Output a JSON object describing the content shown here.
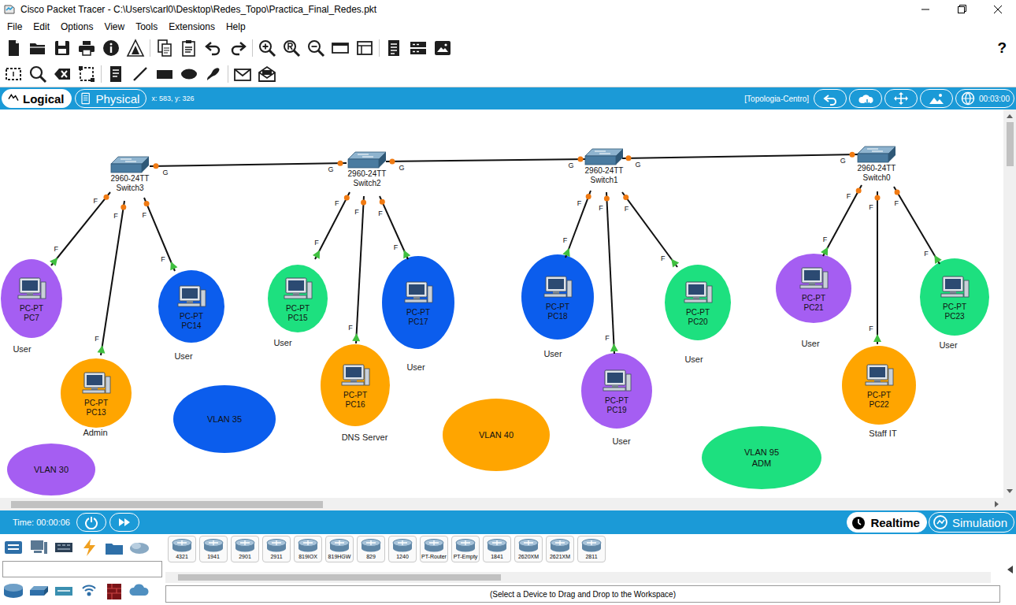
{
  "window": {
    "title": "Cisco Packet Tracer - C:\\Users\\carl0\\Desktop\\Redes_Topo\\Practica_Final_Redes.pkt"
  },
  "menu": [
    "File",
    "Edit",
    "Options",
    "View",
    "Tools",
    "Extensions",
    "Help"
  ],
  "toolbar": {
    "help": "?"
  },
  "view_tabs": [
    {
      "label": "Logical",
      "selected": true
    },
    {
      "label": "Physical",
      "selected": false
    }
  ],
  "cursor": "x: 583, y: 326",
  "workspace": "[Topologia-Centro]",
  "clock": "00:03:00",
  "switches": [
    {
      "model": "2960-24TT",
      "name": "Switch3"
    },
    {
      "model": "2960-24TT",
      "name": "Switch2"
    },
    {
      "model": "2960-24TT",
      "name": "Switch1"
    },
    {
      "model": "2960-24TT",
      "name": "Switch0"
    }
  ],
  "pcs": [
    {
      "type": "PC-PT",
      "name": "PC7",
      "role": "User",
      "color": "#a55ef2"
    },
    {
      "type": "PC-PT",
      "name": "PC13",
      "role": "Admin",
      "color": "#ffa500"
    },
    {
      "type": "PC-PT",
      "name": "PC14",
      "role": "User",
      "color": "#0b5ded"
    },
    {
      "type": "PC-PT",
      "name": "PC15",
      "role": "User",
      "color": "#1de07f"
    },
    {
      "type": "PC-PT",
      "name": "PC16",
      "role": "DNS Server",
      "color": "#ffa500"
    },
    {
      "type": "PC-PT",
      "name": "PC17",
      "role": "User",
      "color": "#0b5ded"
    },
    {
      "type": "PC-PT",
      "name": "PC18",
      "role": "User",
      "color": "#0b5ded"
    },
    {
      "type": "PC-PT",
      "name": "PC19",
      "role": "User",
      "color": "#a55ef2"
    },
    {
      "type": "PC-PT",
      "name": "PC20",
      "role": "User",
      "color": "#1de07f"
    },
    {
      "type": "PC-PT",
      "name": "PC21",
      "role": "User",
      "color": "#a55ef2"
    },
    {
      "type": "PC-PT",
      "name": "PC22",
      "role": "Staff IT",
      "color": "#ffa500"
    },
    {
      "type": "PC-PT",
      "name": "PC23",
      "role": "User",
      "color": "#1de07f"
    }
  ],
  "links": [
    {
      "a_port": "G",
      "b_port": "G",
      "a_status": "amber",
      "b_status": "amber"
    },
    {
      "a_port": "G",
      "b_port": "G",
      "a_status": "amber",
      "b_status": "amber"
    },
    {
      "a_port": "G",
      "b_port": "G",
      "a_status": "amber",
      "b_status": "amber"
    },
    {
      "a_port": "F",
      "b_port": "F",
      "a_status": "amber",
      "b_status": "up"
    },
    {
      "a_port": "F",
      "b_port": "F",
      "a_status": "amber",
      "b_status": "up"
    },
    {
      "a_port": "F",
      "b_port": "F",
      "a_status": "amber",
      "b_status": "up"
    },
    {
      "a_port": "F",
      "b_port": "F",
      "a_status": "amber",
      "b_status": "up"
    },
    {
      "a_port": "F",
      "b_port": "F",
      "a_status": "amber",
      "b_status": "up"
    },
    {
      "a_port": "F",
      "b_port": "F",
      "a_status": "amber",
      "b_status": "up"
    },
    {
      "a_port": "F",
      "b_port": "F",
      "a_status": "amber",
      "b_status": "up"
    },
    {
      "a_port": "F",
      "b_port": "F",
      "a_status": "amber",
      "b_status": "up"
    },
    {
      "a_port": "F",
      "b_port": "F",
      "a_status": "amber",
      "b_status": "up"
    },
    {
      "a_port": "F",
      "b_port": "F",
      "a_status": "amber",
      "b_status": "up"
    },
    {
      "a_port": "F",
      "b_port": "F",
      "a_status": "amber",
      "b_status": "up"
    },
    {
      "a_port": "F",
      "b_port": "F",
      "a_status": "amber",
      "b_status": "up"
    }
  ],
  "vlans": [
    {
      "lines": [
        "VLAN 35"
      ],
      "color": "#0b5ded"
    },
    {
      "lines": [
        "VLAN 40"
      ],
      "color": "#ffa500"
    },
    {
      "lines": [
        "VLAN 95",
        "ADM"
      ],
      "color": "#1de07f"
    },
    {
      "lines": [
        "VLAN 30"
      ],
      "color": "#a55ef2"
    }
  ],
  "sim": {
    "time": "Time: 00:00:06",
    "modes": [
      {
        "label": "Realtime",
        "selected": true
      },
      {
        "label": "Simulation",
        "selected": false
      }
    ]
  },
  "devices": {
    "models": [
      "4321",
      "1941",
      "2901",
      "2911",
      "819IOX",
      "819HGW",
      "829",
      "1240",
      "PT-Router",
      "PT-Empty",
      "1841",
      "2620XM",
      "2621XM",
      "2811"
    ],
    "hint": "(Select a Device to Drag and Drop to the Workspace)"
  }
}
